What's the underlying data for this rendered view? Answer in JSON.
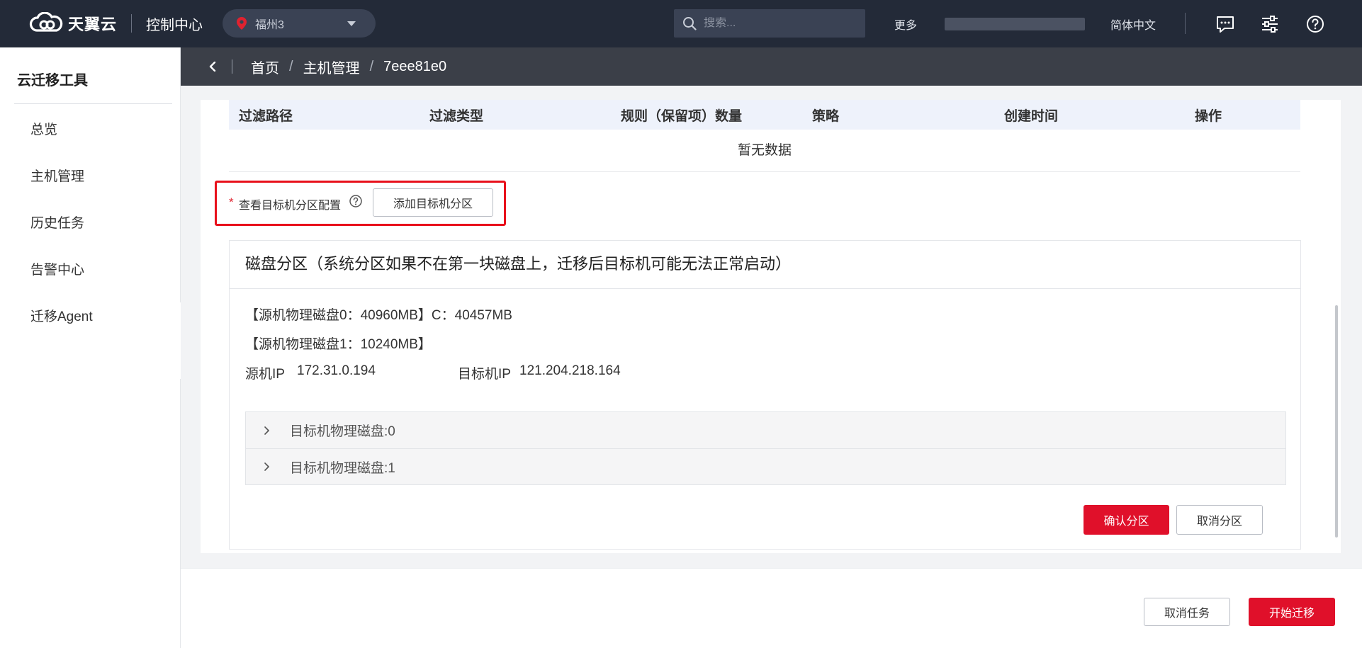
{
  "header": {
    "brand": "天翼云",
    "console": "控制中心",
    "region": "福州3",
    "search_placeholder": "搜索...",
    "more": "更多",
    "language": "简体中文"
  },
  "sidebar": {
    "title": "云迁移工具",
    "items": [
      {
        "label": "总览"
      },
      {
        "label": "主机管理"
      },
      {
        "label": "历史任务"
      },
      {
        "label": "告警中心"
      },
      {
        "label": "迁移Agent"
      }
    ]
  },
  "breadcrumb": {
    "items": [
      "首页",
      "主机管理",
      "7eee81e0"
    ],
    "separator": "/"
  },
  "filter_table": {
    "columns": [
      "过滤路径",
      "过滤类型",
      "规则（保留项）数量",
      "策略",
      "创建时间",
      "操作"
    ],
    "empty_text": "暂无数据"
  },
  "partition_config": {
    "required_mark": "*",
    "label": "查看目标机分区配置",
    "add_button": "添加目标机分区"
  },
  "disk_partition": {
    "title": "磁盘分区（系统分区如果不在第一块磁盘上，迁移后目标机可能无法正常启动）",
    "source_disks": [
      "【源机物理磁盘0：40960MB】C：40457MB",
      "【源机物理磁盘1：10240MB】"
    ],
    "source_ip_label": "源机IP",
    "source_ip": "172.31.0.194",
    "target_ip_label": "目标机IP",
    "target_ip": "121.204.218.164",
    "target_disks": [
      "目标机物理磁盘:0",
      "目标机物理磁盘:1"
    ],
    "confirm_button": "确认分区",
    "cancel_button": "取消分区"
  },
  "footer": {
    "cancel_task": "取消任务",
    "start_migration": "开始迁移"
  },
  "colors": {
    "topbar": "#232a38",
    "breadcrumb_bar": "#3b3f48",
    "accent_red": "#e0102a",
    "highlight_border": "#e8101b",
    "table_header_bg": "#eef2fb"
  }
}
